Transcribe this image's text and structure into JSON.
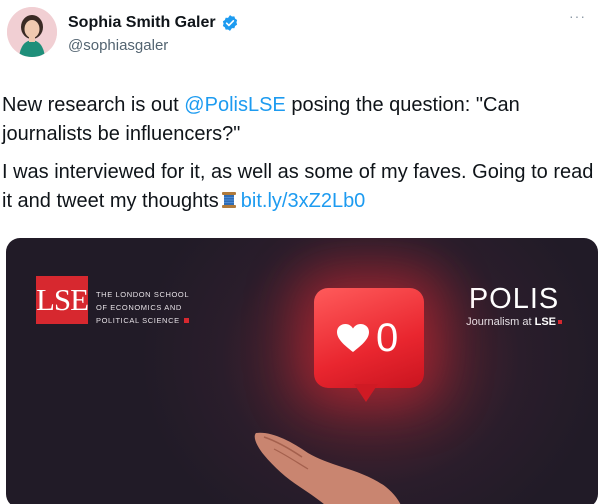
{
  "tweet": {
    "author": {
      "display_name": "Sophia Smith Galer",
      "handle": "@sophiasgaler",
      "verified": true
    },
    "more_label": "···",
    "text": {
      "line1_prefix": "New research is out ",
      "line1_mention": "@PolisLSE",
      "line1_suffix": " posing the question: \"Can journalists be influencers?\"",
      "line2_prefix": "I was interviewed for it, as well as some of my faves. Going to read it and tweet my thoughts",
      "line2_link": "bit.ly/3xZ2Lb0"
    },
    "media": {
      "lse_logo": "LSE",
      "lse_line1": "THE LONDON SCHOOL",
      "lse_line2": "OF ECONOMICS AND",
      "lse_line3": "POLITICAL SCIENCE",
      "polis_title": "POLIS",
      "polis_sub_prefix": "Journalism at ",
      "polis_sub_bold": "LSE",
      "like_count": "0"
    }
  },
  "colors": {
    "link": "#1d9bf0",
    "verified": "#1d9bf0",
    "lse_red": "#d7282f",
    "bubble_red": "#e9262f"
  },
  "icons": [
    "verified-badge-icon",
    "more-options-icon",
    "spool-emoji-icon",
    "heart-icon",
    "hand-icon"
  ]
}
